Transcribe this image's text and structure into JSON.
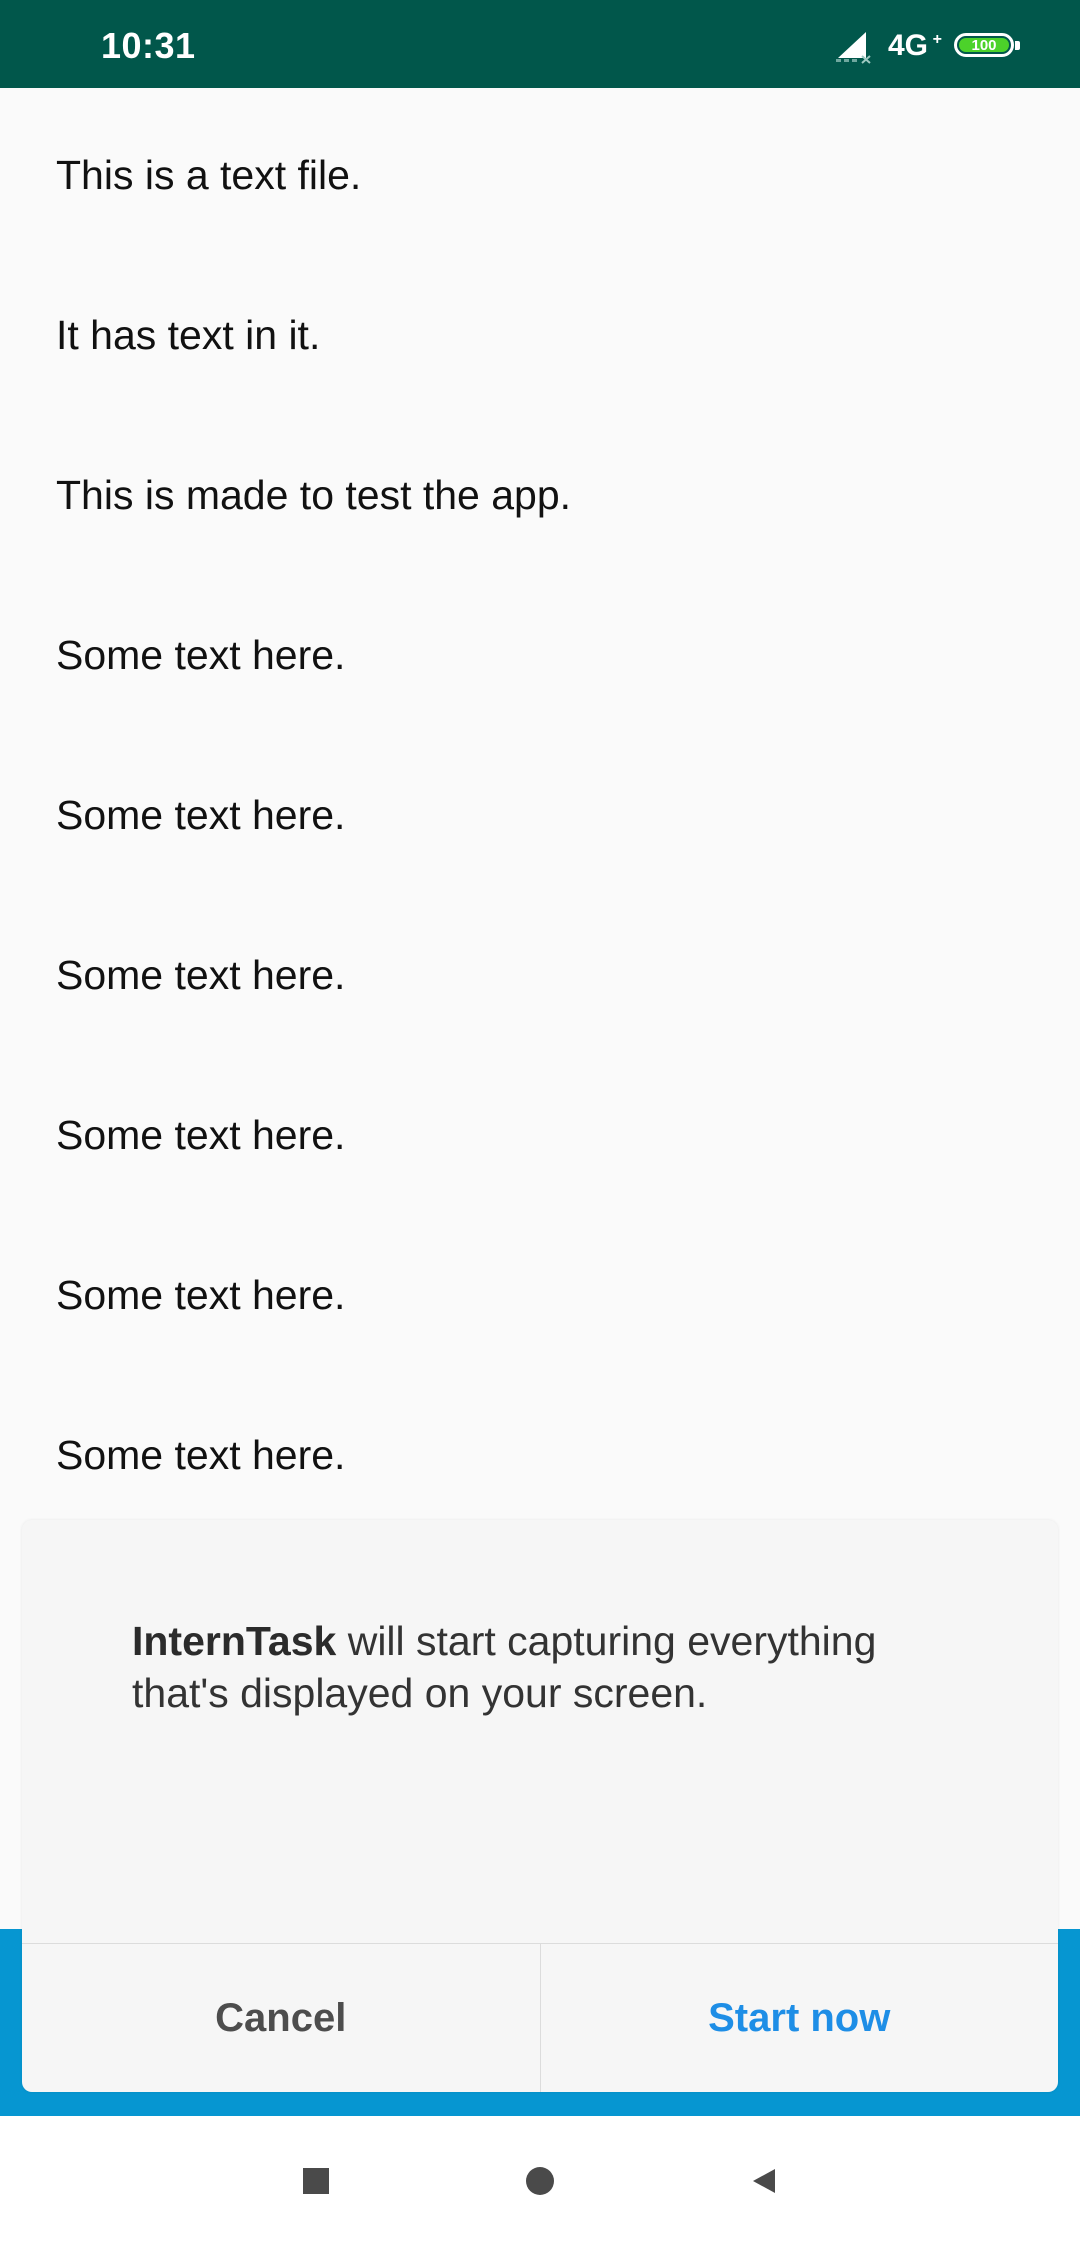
{
  "status_bar": {
    "time": "10:31",
    "network": "4G",
    "network_sup": "+",
    "battery": "100",
    "battery_color": "#4cd22a",
    "background": "#01574b"
  },
  "document": {
    "lines": [
      "This is a text file.",
      "It has text in it.",
      "This is made to test the app.",
      "Some text here.",
      "Some text here.",
      "Some text here.",
      "Some text here.",
      "Some text here.",
      "Some text here."
    ]
  },
  "dialog": {
    "app_name": "InternTask",
    "message": " will start capturing everything that's displayed on your screen.",
    "cancel_label": "Cancel",
    "start_label": "Start now",
    "accent_color": "#1e8ee6"
  },
  "nav_bar": {
    "recents_icon": "square-recents-icon",
    "home_icon": "circle-home-icon",
    "back_icon": "triangle-back-icon"
  }
}
